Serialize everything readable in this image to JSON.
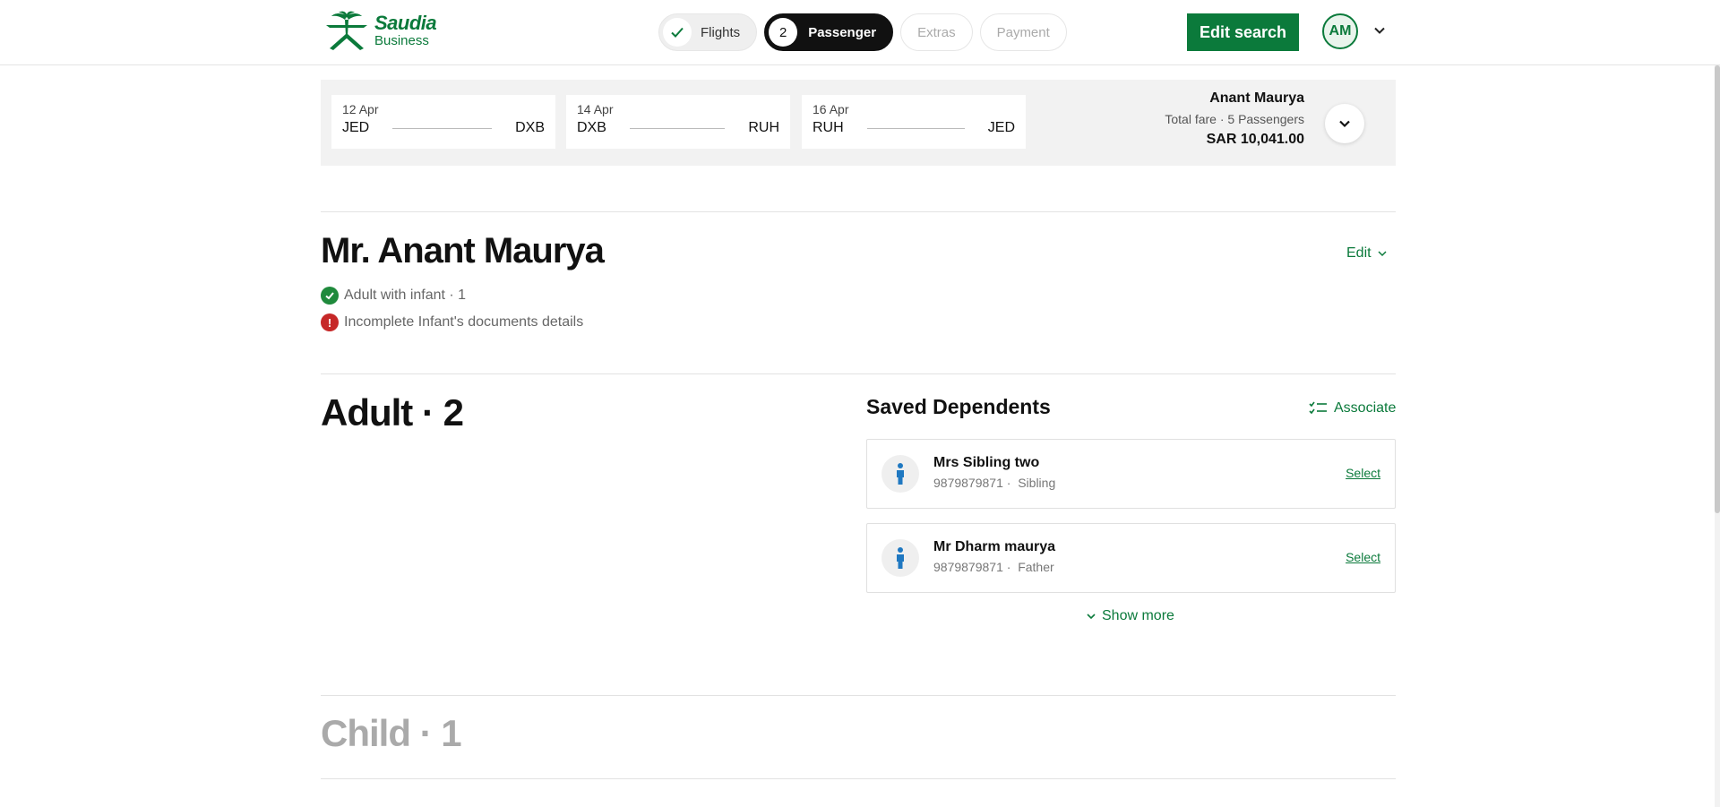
{
  "header": {
    "logo": {
      "brand": "Saudia",
      "sub": "Business"
    },
    "steps": [
      {
        "label": "Flights",
        "state": "done"
      },
      {
        "label": "Passenger",
        "number": "2",
        "state": "active"
      },
      {
        "label": "Extras",
        "state": "pending"
      },
      {
        "label": "Payment",
        "state": "pending"
      }
    ],
    "edit_search_label": "Edit search",
    "avatar_initials": "AM"
  },
  "summary": {
    "segments": [
      {
        "date": "12 Apr",
        "from": "JED",
        "to": "DXB"
      },
      {
        "date": "14 Apr",
        "from": "DXB",
        "to": "RUH"
      },
      {
        "date": "16 Apr",
        "from": "RUH",
        "to": "JED"
      }
    ],
    "fare": {
      "name": "Anant Maurya",
      "subtitle": "Total fare · 5 Passengers",
      "amount": "SAR 10,041.00"
    }
  },
  "passenger": {
    "name": "Mr. Anant Maurya",
    "edit_label": "Edit",
    "statuses": [
      {
        "text": "Adult with infant · 1",
        "type": "ok"
      },
      {
        "text": "Incomplete Infant's documents details",
        "type": "error"
      }
    ]
  },
  "adult_section": {
    "title": "Adult · 2"
  },
  "dependents": {
    "title": "Saved Dependents",
    "associate_label": "Associate",
    "items": [
      {
        "name": "Mrs Sibling two",
        "phone": "9879879871 ·",
        "relation": "Sibling",
        "action": "Select"
      },
      {
        "name": "Mr Dharm maurya",
        "phone": "9879879871 ·",
        "relation": "Father",
        "action": "Select"
      }
    ],
    "show_more_label": "Show more"
  },
  "child_section": {
    "title": "Child · 1"
  },
  "colors": {
    "brand_green": "#0b7a3b",
    "error_red": "#c62828",
    "dependent_icon_blue": "#1f78c1"
  }
}
